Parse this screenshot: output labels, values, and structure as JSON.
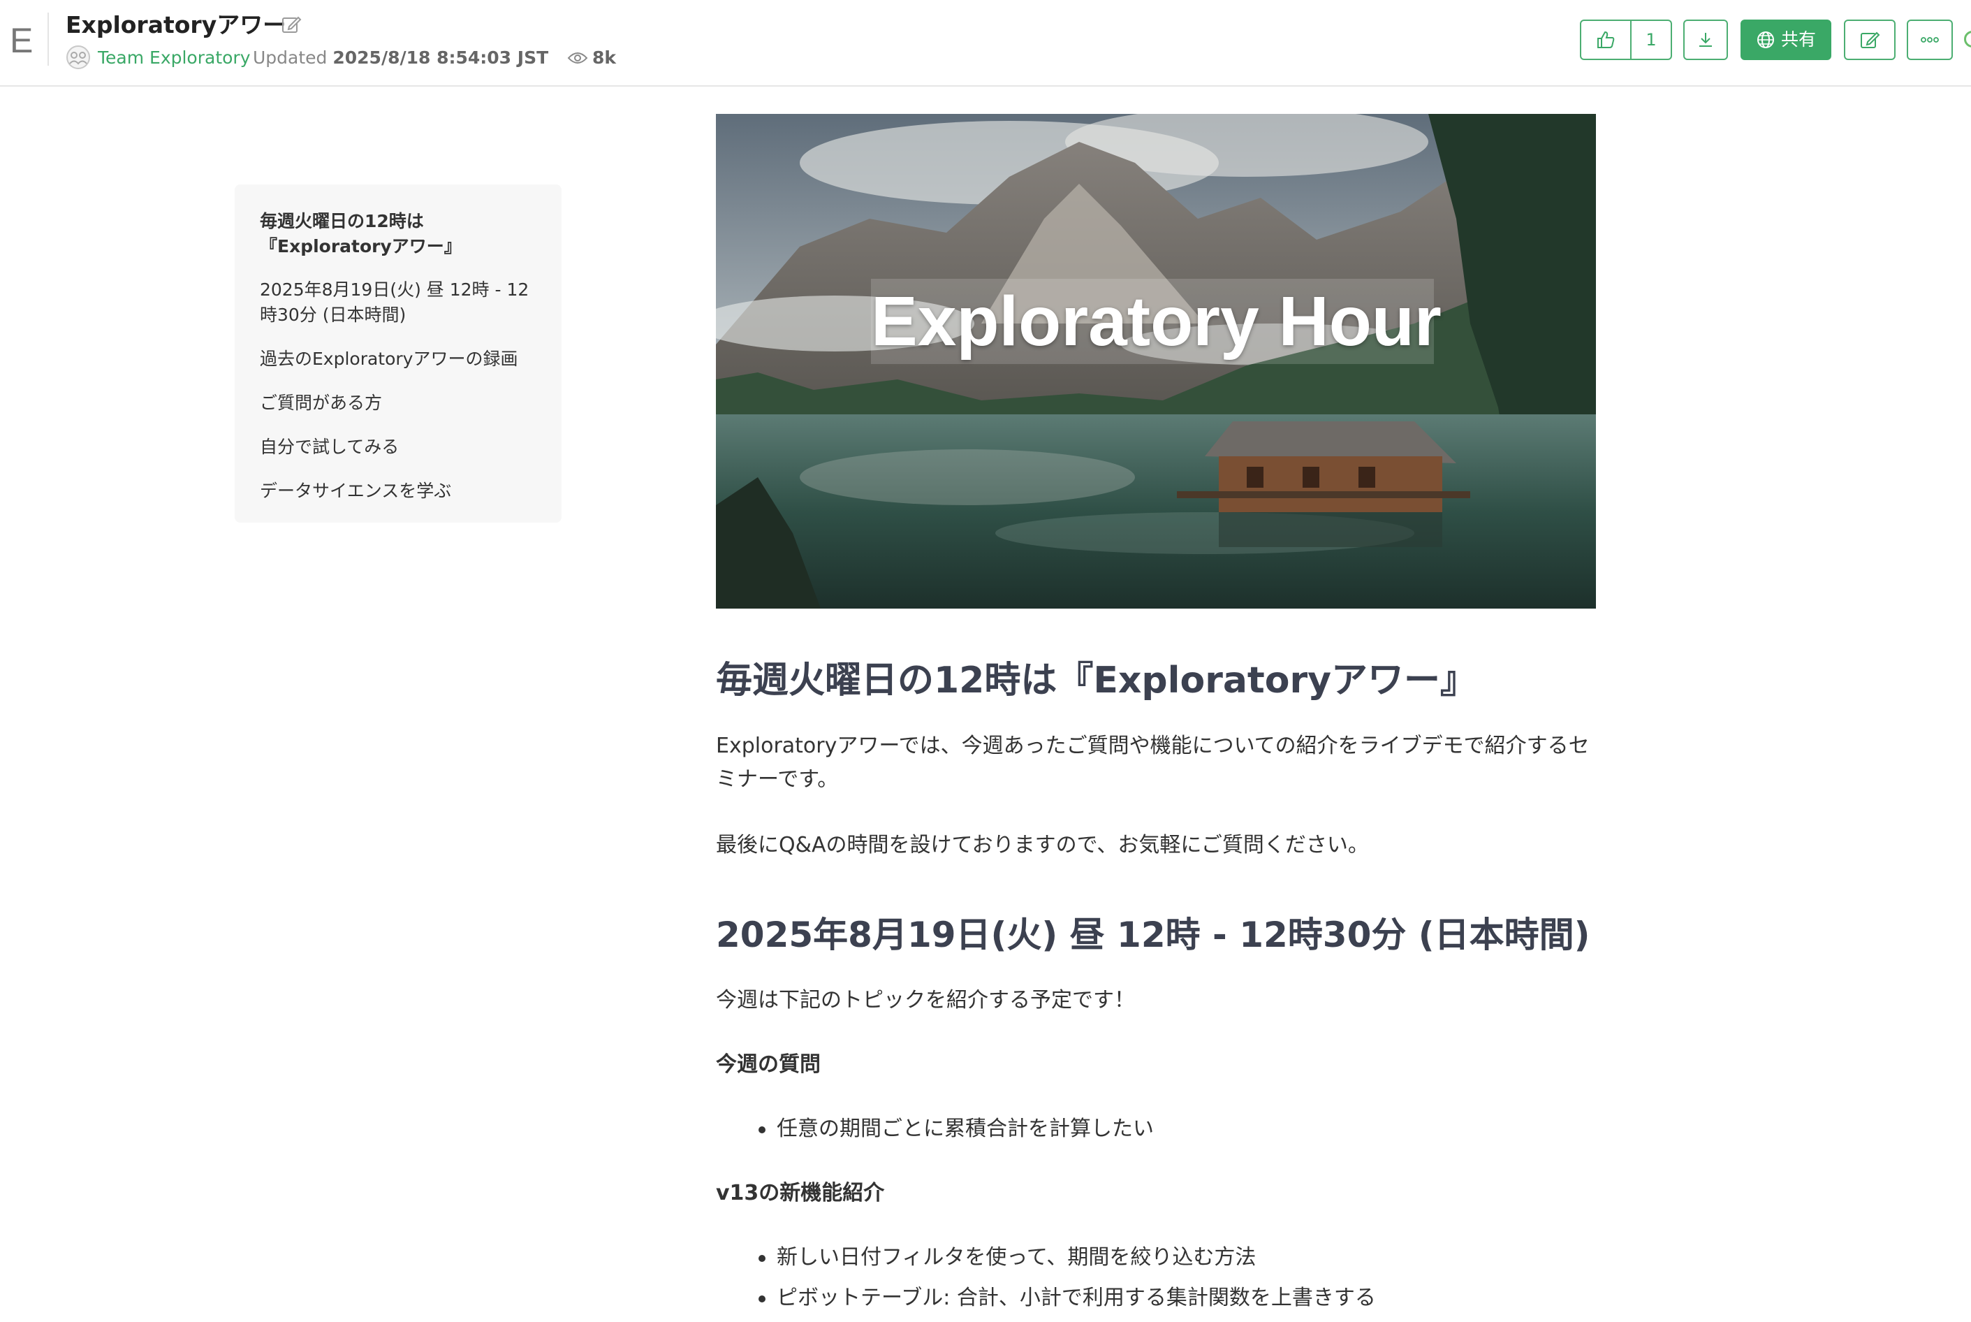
{
  "header": {
    "logo_letter": "E",
    "title": "Exploratoryアワー",
    "team": "Team Exploratory",
    "updated_label": "Updated",
    "updated_value": "2025/8/18 8:54:03 JST",
    "views": "8k",
    "like_count": "1",
    "share_label": "共有"
  },
  "toc": {
    "items": [
      "毎週火曜日の12時は『Exploratoryアワー』",
      "2025年8月19日(火) 昼 12時 - 12時30分 (日本時間)",
      "過去のExploratoryアワーの録画",
      "ご質問がある方",
      "自分で試してみる",
      "データサイエンスを学ぶ"
    ]
  },
  "hero": {
    "caption": "Exploratory Hour"
  },
  "content": {
    "h1_intro": "毎週火曜日の12時は『Exploratoryアワー』",
    "p_intro": "Exploratoryアワーでは、今週あったご質問や機能についての紹介をライブデモで紹介するセミナーです。",
    "p_qa": "最後にQ&Aの時間を設けておりますので、お気軽にご質問ください。",
    "h1_date": "2025年8月19日(火) 昼 12時 - 12時30分 (日本時間)",
    "p_topics": "今週は下記のトピックを紹介する予定です！",
    "questions_heading": "今週の質問",
    "questions": [
      "任意の期間ごとに累積合計を計算したい"
    ],
    "features_heading": "v13の新機能紹介",
    "features": [
      "新しい日付フィルタを使って、期間を絞り込む方法",
      "ピボットテーブル: 合計、小計で利用する集計関数を上書きする"
    ]
  },
  "colors": {
    "accent": "#3aa866",
    "heading": "#3c4150",
    "toc_bg": "#f7f7f7"
  },
  "icons": [
    "edit-icon",
    "team-icon",
    "eye-icon",
    "thumbs-up-icon",
    "download-icon",
    "globe-icon",
    "more-icon"
  ]
}
